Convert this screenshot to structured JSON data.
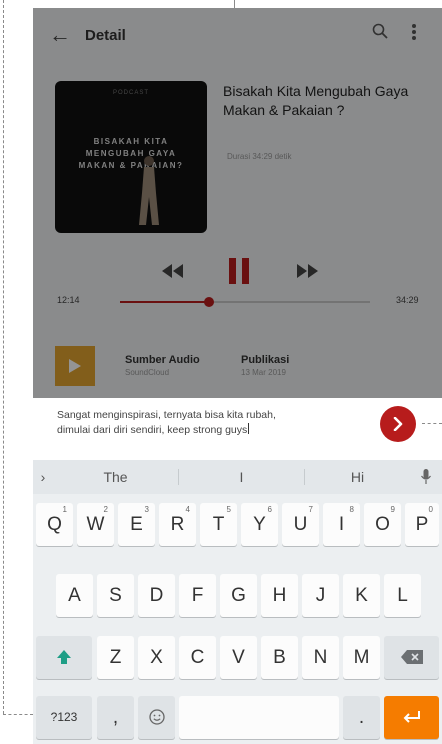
{
  "appbar": {
    "title": "Detail",
    "icons": [
      "back-arrow-icon",
      "search-icon",
      "more-vert-icon"
    ]
  },
  "cover": {
    "top_text": "PODCAST",
    "lines": [
      "BISAKAH KITA",
      "MENGUBAH GAYA",
      "MAKAN & PAKAIAN?"
    ],
    "subtitle": ""
  },
  "episode": {
    "title": "Bisakah Kita Mengubah Gaya Makan & Pakaian ?",
    "duration_label": "Durasi 34:29 detik"
  },
  "player": {
    "elapsed": "12:14",
    "total": "34:29",
    "progress": 0.355,
    "state": "playing"
  },
  "info": {
    "source_label": "Sumber Audio",
    "source_value": "SoundCloud",
    "publish_label": "Publikasi",
    "publish_value": "13 Mar 2019"
  },
  "comment": {
    "line1": "Sangat menginspirasi, ternyata bisa kita rubah,",
    "line2": "dimulai dari diri sendiri, keep strong guys"
  },
  "keyboard": {
    "suggestions": [
      "The",
      "I",
      "Hi"
    ],
    "row1": [
      {
        "label": "Q",
        "hint": "1"
      },
      {
        "label": "W",
        "hint": "2"
      },
      {
        "label": "E",
        "hint": "3"
      },
      {
        "label": "R",
        "hint": "4"
      },
      {
        "label": "T",
        "hint": "5"
      },
      {
        "label": "Y",
        "hint": "6"
      },
      {
        "label": "U",
        "hint": "7"
      },
      {
        "label": "I",
        "hint": "8"
      },
      {
        "label": "O",
        "hint": "9"
      },
      {
        "label": "P",
        "hint": "0"
      }
    ],
    "row2": [
      "A",
      "S",
      "D",
      "F",
      "G",
      "H",
      "J",
      "K",
      "L"
    ],
    "row3": [
      "Z",
      "X",
      "C",
      "V",
      "B",
      "N",
      "M"
    ],
    "symbols_label": "?123",
    "comma": ",",
    "period": "."
  },
  "colors": {
    "accent": "#b71c1c",
    "enter_key": "#f57c00",
    "source_tile": "#e1a330",
    "shift": "#1e9e86"
  }
}
